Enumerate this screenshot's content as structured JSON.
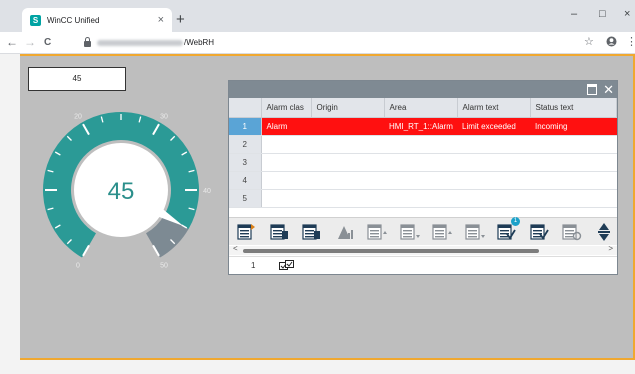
{
  "browser": {
    "tab_title": "WinCC Unified",
    "favicon_letter": "S",
    "url_path": "/WebRH",
    "tab_close_glyph": "×",
    "new_tab_glyph": "+",
    "minimize_glyph": "–",
    "maximize_glyph": "□",
    "close_glyph": "×",
    "back_glyph": "←",
    "forward_glyph": "→",
    "reload_glyph": "C",
    "star_glyph": "☆",
    "menu_glyph": "⋮"
  },
  "hmi": {
    "value_display": "45",
    "gauge": {
      "value": 45,
      "value_label": "45",
      "min": 0,
      "max": 50,
      "ticks": [
        "0",
        "10",
        "20",
        "30",
        "40",
        "50"
      ],
      "arc_color": "#2b9a96",
      "warning_color": "#7d8a93"
    }
  },
  "alarm_control": {
    "columns": [
      "",
      "Alarm clas",
      "Origin",
      "Area",
      "Alarm text",
      "Status text"
    ],
    "rows": [
      {
        "num": "1",
        "alarm_class": "Alarm",
        "origin": "",
        "area": "HMI_RT_1::Alarm",
        "alarm_text": "Limit exceeded",
        "status_text": "Incoming",
        "active": true
      },
      {
        "num": "2",
        "alarm_class": "",
        "origin": "",
        "area": "",
        "alarm_text": "",
        "status_text": "",
        "active": false
      },
      {
        "num": "3",
        "alarm_class": "",
        "origin": "",
        "area": "",
        "alarm_text": "",
        "status_text": "",
        "active": false
      },
      {
        "num": "4",
        "alarm_class": "",
        "origin": "",
        "area": "",
        "alarm_text": "",
        "status_text": "",
        "active": false
      },
      {
        "num": "5",
        "alarm_class": "",
        "origin": "",
        "area": "",
        "alarm_text": "",
        "status_text": "",
        "active": false
      }
    ],
    "toolbar_badge": "1",
    "scroll_left_glyph": "<",
    "scroll_right_glyph": ">",
    "status_count": "1",
    "maximize_glyph": "",
    "close_glyph": "✕",
    "colors": {
      "active_row": "#ff1010",
      "selected_row_number": "#5aa4d6"
    }
  }
}
